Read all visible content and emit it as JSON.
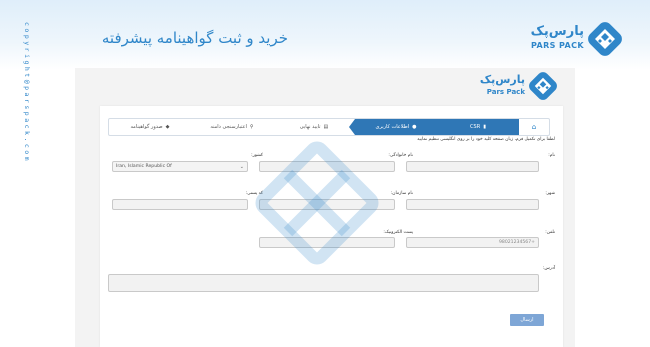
{
  "header": {
    "title": "خرید و ثبت گواهینامه پیشرفته",
    "brand_fa": "پارس‌پک",
    "brand_en": "PARS PACK",
    "copyright": "copyright@parspack.com"
  },
  "app": {
    "brand_fa": "پارس‌پک",
    "brand_en": "Pars Pack"
  },
  "steps": [
    {
      "label": "خانه",
      "icon": "home-icon"
    },
    {
      "label": "CSR",
      "icon": "file-icon"
    },
    {
      "label": "اطلاعات کاربری",
      "icon": "user-icon"
    },
    {
      "label": "تایید نهایی",
      "icon": "checklist-icon"
    },
    {
      "label": "اعتبارسنجی دامنه",
      "icon": "search-icon"
    },
    {
      "label": "صدور گواهینامه",
      "icon": "certificate-icon"
    }
  ],
  "form": {
    "intro": "لطفا برای تکمیل فرم، زبان صفحه کلید خود را بر روی انگلیسی تنظیم نمایید",
    "first_name_label": "نام:",
    "last_name_label": "نام خانوادگی:",
    "country_label": "کشور:",
    "country_value": "Iran, Islamic Republic Of",
    "city_label": "شهر:",
    "organization_label": "نام سازمان:",
    "postal_code_label": "کد پستی:",
    "phone_label": "تلفن:",
    "phone_placeholder": "+98021234567",
    "email_label": "پست الکترونیک:",
    "address_label": "آدرس:",
    "submit_label": "ارسال"
  },
  "colors": {
    "accent": "#2f86c9",
    "active_step": "#2f77b6",
    "button": "#7ea6d6"
  }
}
